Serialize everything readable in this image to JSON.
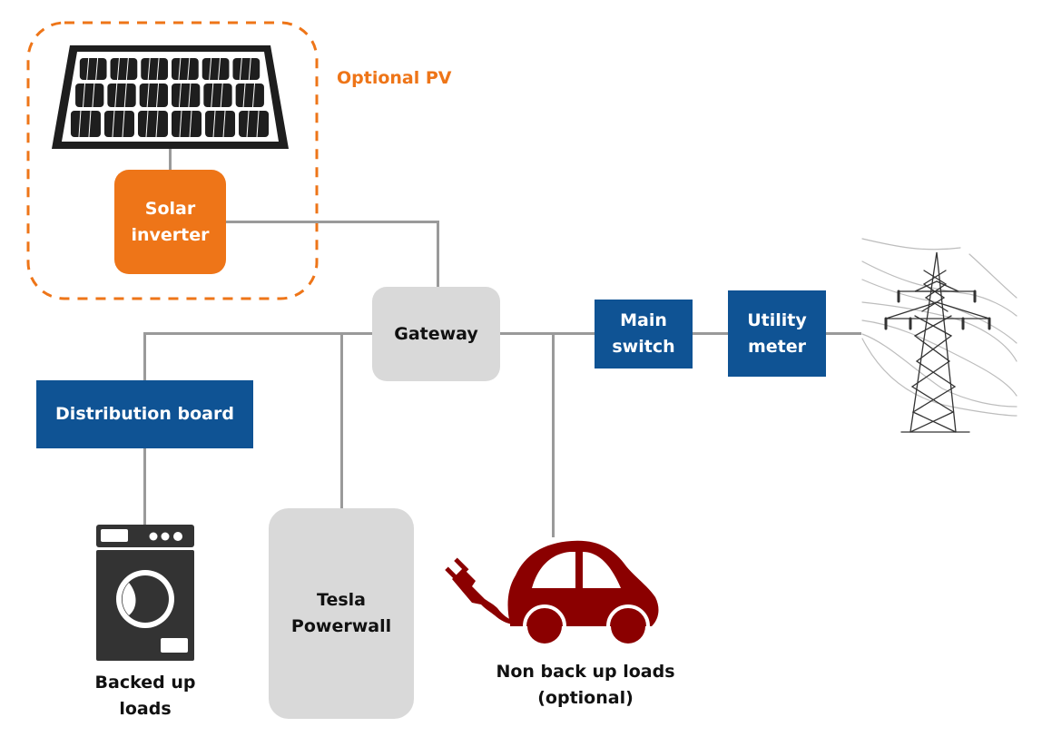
{
  "colors": {
    "optional_orange": "#ee7518",
    "utility_blue": "#0f5394",
    "device_grey": "#d9d9d9",
    "wire_grey": "#9a9a9a",
    "ev_red": "#8b0000",
    "appliance_dark": "#333333"
  },
  "optional_pv": {
    "label": "Optional PV",
    "solar_panel_icon": "solar-panel",
    "inverter": {
      "line1": "Solar",
      "line2": "inverter"
    }
  },
  "gateway": {
    "label": "Gateway"
  },
  "main_switch": {
    "line1": "Main",
    "line2": "switch"
  },
  "utility_meter": {
    "line1": "Utility",
    "line2": "meter"
  },
  "grid_icon": "power-transmission-tower",
  "distribution_board": {
    "label": "Distribution board"
  },
  "backed_up_loads": {
    "icon": "washing-machine",
    "line1": "Backed up",
    "line2": "loads"
  },
  "powerwall": {
    "line1": "Tesla",
    "line2": "Powerwall"
  },
  "non_backup_loads": {
    "icon": "electric-car",
    "line1": "Non back up loads",
    "line2": "(optional)"
  }
}
